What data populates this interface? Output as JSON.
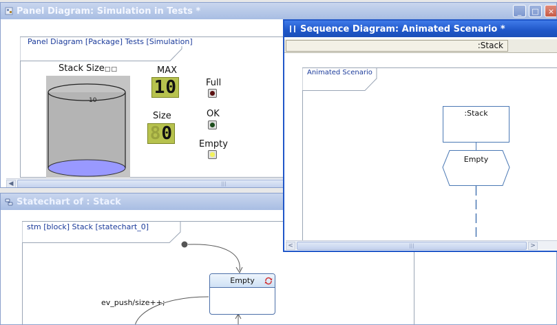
{
  "panel_window": {
    "title": "Panel Diagram: Simulation in Tests *",
    "frame_label": "Panel Diagram [Package] Tests [Simulation]",
    "gauge": {
      "label": "Stack Size",
      "label_suffix": "□□",
      "tick_value": "10"
    },
    "max_display": {
      "label": "MAX",
      "value": "10"
    },
    "size_display": {
      "label": "Size",
      "value": "0",
      "ghost": "8"
    },
    "indicators": [
      {
        "label": "Full",
        "color": "#5a1010"
      },
      {
        "label": "OK",
        "color": "#1c4d1c"
      },
      {
        "label": "Empty",
        "color": "#f2f25a"
      }
    ],
    "scroll_grip": "|||"
  },
  "statechart_window": {
    "title": "Statechart of : Stack",
    "frame_label": "stm [block] Stack [statechart_0]",
    "state_name": "Empty",
    "transition_label": "ev_push/size++;"
  },
  "sequence_window": {
    "title": "Sequence Diagram: Animated Scenario *",
    "header_lifeline": ":Stack",
    "frame_label": "Animated Scenario",
    "lifeline_name": ":Stack",
    "state_marker": "Empty",
    "scroll_left": "<",
    "scroll_right": ">",
    "scroll_grip": "|||"
  },
  "colors": {
    "active_title": "#2458c8",
    "inactive_title": "#b6c7ea",
    "lcd_green": "#b7c24e",
    "gauge_fill": "#9999ff",
    "state_fill": "#dbe9f7"
  }
}
